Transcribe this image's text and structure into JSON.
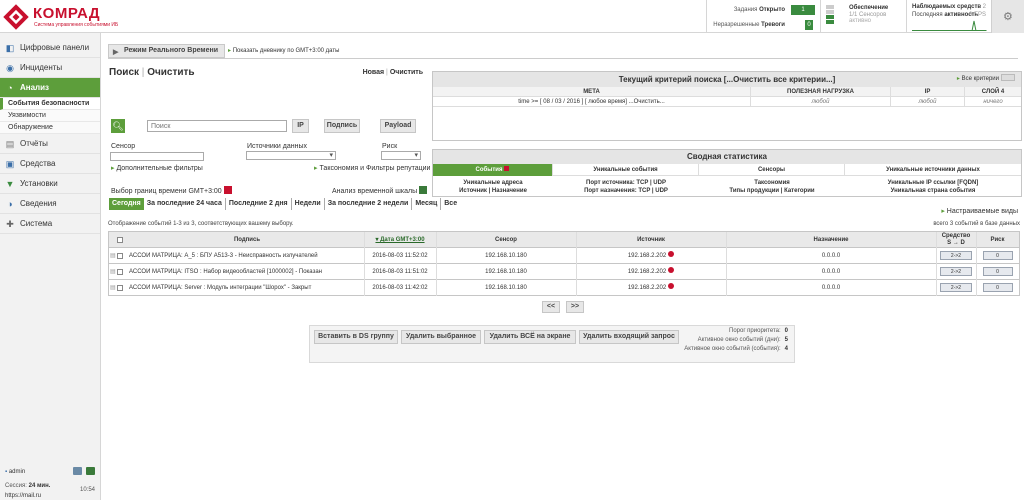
{
  "brand": {
    "name": "КОМРАД",
    "tagline": "Система управления событиями ИБ"
  },
  "header": {
    "tasks_label": "Задания",
    "tasks_state": "Открыто",
    "tasks_count": "1",
    "alarms_label": "Неразрешенные",
    "alarms_state": "Тревоги",
    "alarms_count": "0",
    "provision_title": "Обеспечение",
    "provision_sensors": "1/1 Сенсоров",
    "provision_state": "активно",
    "monitor_title": "Наблюдаемых средств",
    "monitor_count": "2",
    "monitor_activity_label": "Последняя",
    "monitor_activity_state": "активность",
    "monitor_eps": "0 EPS"
  },
  "sidebar": {
    "items": [
      {
        "label": "Цифровые панели",
        "icon": "dashboard-icon"
      },
      {
        "label": "Инциденты",
        "icon": "incident-icon"
      },
      {
        "label": "Анализ",
        "icon": "analysis-icon"
      },
      {
        "label": "Отчёты",
        "icon": "reports-icon"
      },
      {
        "label": "Средства",
        "icon": "assets-icon"
      },
      {
        "label": "Установки",
        "icon": "settings-filter-icon"
      },
      {
        "label": "Сведения",
        "icon": "info-icon"
      },
      {
        "label": "Система",
        "icon": "system-icon"
      }
    ],
    "subitems": [
      "События безопасности",
      "Уязвимости",
      "Обнаружение"
    ],
    "footer": {
      "user": "admin",
      "session_label": "Сессия:",
      "session_time": "24 мин.",
      "clock": "10:54",
      "url": "https://mail.ru"
    }
  },
  "realtime": {
    "button": "Режим Реального Времени",
    "gmt_link": "Показать дневнику по GMT+3:00 даты"
  },
  "search": {
    "title": "Поиск",
    "clear": "Очистить",
    "new_link": "Новая",
    "clear_link": "Очистить",
    "placeholder": "Поиск",
    "ip_button": "IP",
    "signature_button": "Подпись",
    "payload_button": "Payload",
    "sensor_label": "Сенсор",
    "sources_label": "Источники данных",
    "risk_label": "Риск",
    "advanced_filters": "Дополнительные фильтры",
    "taxonomy_filters": "Таксономия и Фильтры репутации",
    "time_range_label": "Выбор границ времени GMT+3:00",
    "time_analysis_label": "Анализ временной шкалы",
    "time_tabs": [
      "Сегодня",
      "За последние 24 часа",
      "Последние 2 дня",
      "Недели",
      "За последние 2 недели",
      "Месяц",
      "Все"
    ]
  },
  "criteria": {
    "title": "Текущий критерий поиска",
    "clear_all": "[...Очистить все критерии...]",
    "all_criteria": "Все критерии",
    "columns": [
      "МЕТА",
      "ПОЛЕЗНАЯ НАГРУЗКА",
      "IP",
      "СЛОЙ 4"
    ],
    "meta_value": "time >= [ 08 / 03 / 2016 ] [ любое время] ...Очистить...",
    "payload_value": "любой",
    "ip_value": "любой",
    "layer4_value": "ничего"
  },
  "summary": {
    "title": "Сводная статистика",
    "columns": [
      "События",
      "Уникальные события",
      "Сенсоры",
      "Уникальные источники данных"
    ],
    "links": [
      [
        "Уникальные адреса",
        "Источник | Назначение"
      ],
      [
        "Порт источника: TCP | UDP",
        "Порт назначения: TCP | UDP"
      ],
      [
        "Таксономия",
        "Типы продукции | Категории"
      ],
      [
        "Уникальные IP ссылки [FQDN]",
        "Уникальная страна события"
      ]
    ],
    "custom_views": "Настраиваемые виды"
  },
  "events": {
    "info": "Отображение событий 1-3 из 3, соответствующих вашему выбору.",
    "total": "всего 3 событий в базе данных",
    "columns": {
      "signature": "Подпись",
      "date": "Дата GMT+3:00",
      "sensor": "Сенсор",
      "source": "Источник",
      "destination": "Назначение",
      "vector_top": "Средство",
      "vector_bottom": "S → D",
      "risk": "Риск"
    },
    "rows": [
      {
        "signature": "АССОИ МАТРИЦА: A_5 : БПУ А513-3 - Неисправность излучателей",
        "date": "2016-08-03 11:52:02",
        "sensor": "192.168.10.180",
        "source": "192.168.2.202",
        "destination": "0.0.0.0",
        "vector": "2->2",
        "risk": "0"
      },
      {
        "signature": "АССОИ МАТРИЦА: ITSO : Набор видеообластей [1000002] - Показан",
        "date": "2016-08-03 11:51:02",
        "sensor": "192.168.10.180",
        "source": "192.168.2.202",
        "destination": "0.0.0.0",
        "vector": "2->2",
        "risk": "0"
      },
      {
        "signature": "АССОИ МАТРИЦА: Server : Модуль интеграции \"Шорох\" - Закрыт",
        "date": "2016-08-03 11:42:02",
        "sensor": "192.168.10.180",
        "source": "192.168.2.202",
        "destination": "0.0.0.0",
        "vector": "2->2",
        "risk": "0"
      }
    ]
  },
  "pager": {
    "prev": "<<",
    "next": ">>"
  },
  "actions": {
    "buttons": [
      "Вставить в DS группу",
      "Удалить выбранное",
      "Удалить ВСЁ на экране",
      "Удалить входящий запрос"
    ],
    "stats": [
      {
        "label": "Порог приоритета:",
        "value": "0"
      },
      {
        "label": "Активное окно событий (дни):",
        "value": "5"
      },
      {
        "label": "Активное окно событий (события):",
        "value": "4"
      }
    ]
  },
  "colors": {
    "accent": "#5d9e3b",
    "brand": "#c8102e"
  }
}
